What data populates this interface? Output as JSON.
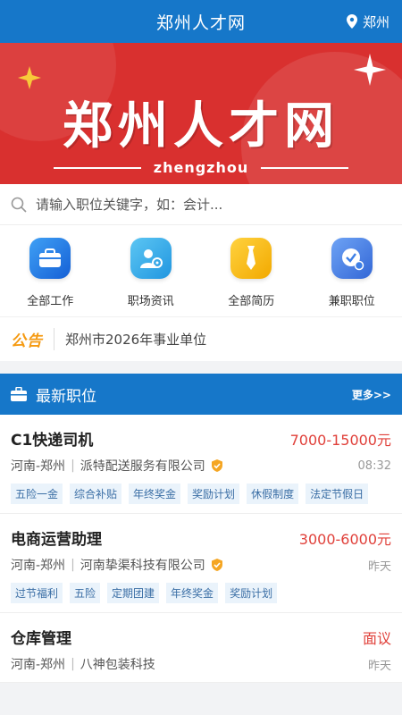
{
  "header": {
    "title": "郑州人才网",
    "city": "郑州"
  },
  "banner": {
    "title": "郑州人才网",
    "subtitle": "zhengzhou"
  },
  "search": {
    "placeholder": "请输入职位关键字，如：会计..."
  },
  "quick_links": [
    {
      "label": "全部工作",
      "icon": "briefcase-icon",
      "color": "#1a73e8"
    },
    {
      "label": "职场资讯",
      "icon": "user-info-icon",
      "color": "#2aa8e8"
    },
    {
      "label": "全部简历",
      "icon": "tie-icon",
      "color": "#f5b400"
    },
    {
      "label": "兼职职位",
      "icon": "clock-check-icon",
      "color": "#3d7fe6"
    }
  ],
  "notice": {
    "badge": "公告",
    "text": "郑州市2026年事业单位"
  },
  "latest": {
    "title": "最新职位",
    "more": "更多>>"
  },
  "jobs": [
    {
      "name": "C1快递司机",
      "salary": "7000-15000元",
      "location": "河南-郑州",
      "company": "派特配送服务有限公司",
      "time": "08:32",
      "verified": true,
      "tags": [
        "五险一金",
        "综合补贴",
        "年终奖金",
        "奖励计划",
        "休假制度",
        "法定节假日"
      ]
    },
    {
      "name": "电商运营助理",
      "salary": "3000-6000元",
      "location": "河南-郑州",
      "company": "河南挚渠科技有限公司",
      "time": "昨天",
      "verified": true,
      "tags": [
        "过节福利",
        "五险",
        "定期团建",
        "年终奖金",
        "奖励计划"
      ]
    },
    {
      "name": "仓库管理",
      "salary": "面议",
      "location": "河南-郑州",
      "company": "八神包装科技",
      "time": "昨天",
      "verified": false,
      "tags": []
    }
  ],
  "colors": {
    "primary": "#1677c9",
    "banner": "#d9302f",
    "salary": "#e0403a",
    "notice": "#f59a12"
  }
}
